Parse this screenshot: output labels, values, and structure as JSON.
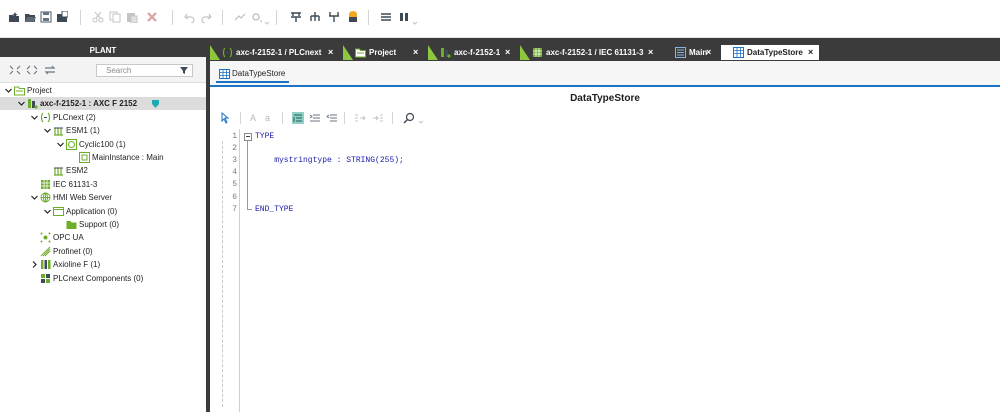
{
  "plant": {
    "header": "PLANT",
    "search_placeholder": "Search",
    "tree": [
      {
        "label": "Project",
        "indent": 0,
        "twisty": "down",
        "icon": "project-folder-icon"
      },
      {
        "label": "axc-f-2152-1 : AXC F 2152",
        "indent": 1,
        "twisty": "down",
        "icon": "controller-icon",
        "selected": true,
        "bold": true
      },
      {
        "label": "PLCnext (2)",
        "indent": 2,
        "twisty": "down",
        "icon": "plcnext-icon"
      },
      {
        "label": "ESM1 (1)",
        "indent": 3,
        "twisty": "down",
        "icon": "esm-icon"
      },
      {
        "label": "Cyclic100 (1)",
        "indent": 4,
        "twisty": "down",
        "icon": "cyclic-task-icon"
      },
      {
        "label": "MainInstance : Main",
        "indent": 5,
        "twisty": "none",
        "icon": "program-instance-icon"
      },
      {
        "label": "ESM2",
        "indent": 3,
        "twisty": "none",
        "icon": "esm-icon"
      },
      {
        "label": "IEC 61131-3",
        "indent": 2,
        "twisty": "none",
        "icon": "iec-icon"
      },
      {
        "label": "HMI Web Server",
        "indent": 2,
        "twisty": "down",
        "icon": "globe-icon"
      },
      {
        "label": "Application (0)",
        "indent": 3,
        "twisty": "down",
        "icon": "application-icon"
      },
      {
        "label": "Support (0)",
        "indent": 4,
        "twisty": "none",
        "icon": "folder-icon"
      },
      {
        "label": "OPC UA",
        "indent": 2,
        "twisty": "none",
        "icon": "opcua-icon"
      },
      {
        "label": "Profinet (0)",
        "indent": 2,
        "twisty": "none",
        "icon": "profinet-icon"
      },
      {
        "label": "Axioline F (1)",
        "indent": 2,
        "twisty": "right",
        "icon": "axioline-icon"
      },
      {
        "label": "PLCnext Components (0)",
        "indent": 2,
        "twisty": "none",
        "icon": "components-icon"
      }
    ]
  },
  "tabs": [
    {
      "label": "axc-f-2152-1 / PLCnext",
      "icon": "plcnext-icon",
      "active": false
    },
    {
      "label": "Project",
      "icon": "project-folder-icon",
      "active": false
    },
    {
      "label": "axc-f-2152-1",
      "icon": "controller-icon",
      "active": false
    },
    {
      "label": "axc-f-2152-1 / IEC 61131-3",
      "icon": "iec-icon",
      "active": false
    },
    {
      "label": "Main",
      "icon": "program-icon",
      "active": false
    },
    {
      "label": "DataTypeStore",
      "icon": "table-icon",
      "active": true
    }
  ],
  "tab_close": "×",
  "editor": {
    "subtab_label": "DataTypeStore",
    "title": "DataTypeStore",
    "toolbar_text": [
      "A",
      "a"
    ],
    "code_lines": [
      {
        "n": "1",
        "text": "TYPE"
      },
      {
        "n": "2",
        "text": ""
      },
      {
        "n": "3",
        "text": "    mystringtype : STRING(255);"
      },
      {
        "n": "4",
        "text": ""
      },
      {
        "n": "5",
        "text": ""
      },
      {
        "n": "6",
        "text": ""
      },
      {
        "n": "7",
        "text": "END_TYPE"
      }
    ]
  },
  "colors": {
    "accent": "#1a73c4",
    "tab_marker": "#8dc63f",
    "dark_bar": "#3b3b3b",
    "keyword": "#1c1ca8"
  }
}
